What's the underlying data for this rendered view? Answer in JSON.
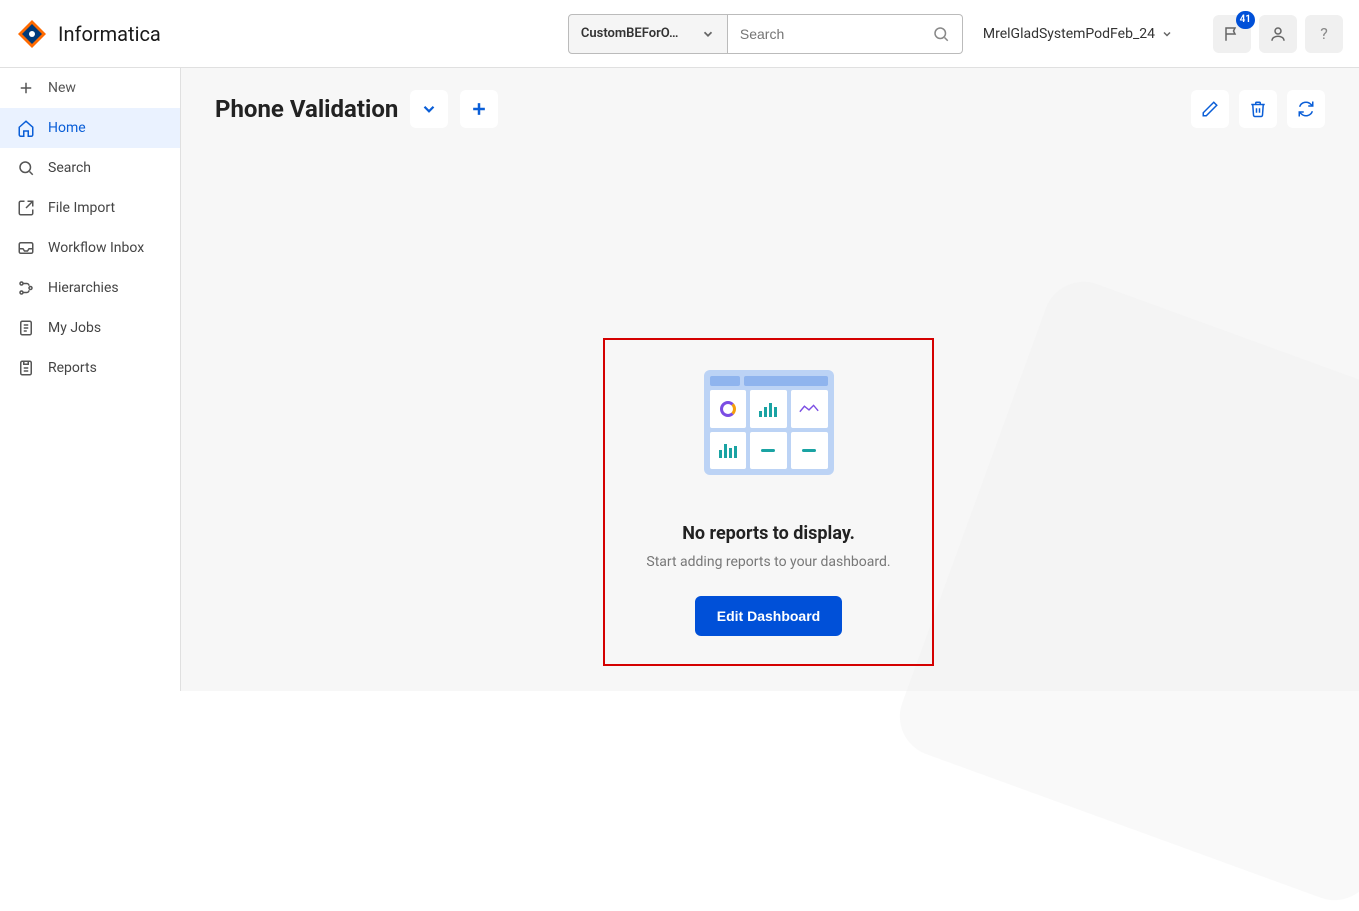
{
  "header": {
    "brand": "Informatica",
    "be_selector": "CustomBEForO…",
    "search_placeholder": "Search",
    "account_name": "MrelGladSystemPodFeb_24",
    "notification_count": "41"
  },
  "sidebar": {
    "items": [
      {
        "label": "New",
        "icon": "plus"
      },
      {
        "label": "Home",
        "icon": "home"
      },
      {
        "label": "Search",
        "icon": "search"
      },
      {
        "label": "File Import",
        "icon": "import"
      },
      {
        "label": "Workflow Inbox",
        "icon": "inbox"
      },
      {
        "label": "Hierarchies",
        "icon": "hier"
      },
      {
        "label": "My Jobs",
        "icon": "jobs"
      },
      {
        "label": "Reports",
        "icon": "reports"
      }
    ]
  },
  "page": {
    "title": "Phone Validation",
    "empty_title": "No reports to display.",
    "empty_subtitle": "Start adding reports to your dashboard.",
    "edit_button": "Edit Dashboard"
  }
}
